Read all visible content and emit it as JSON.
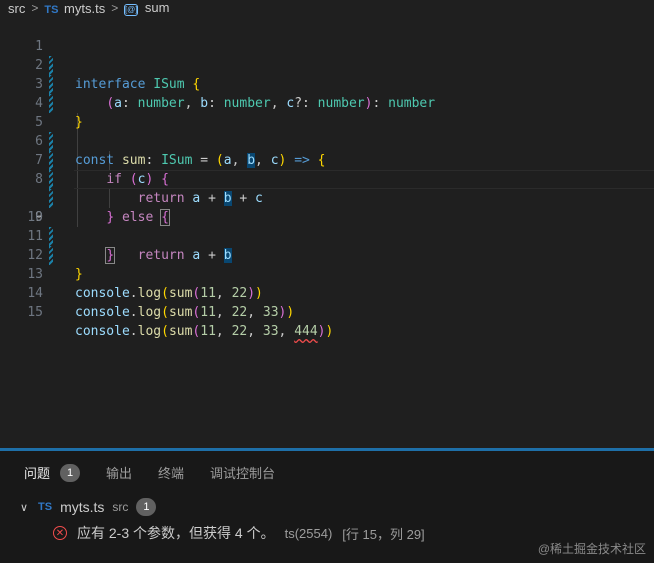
{
  "breadcrumb": {
    "folder": "src",
    "file_lang": "TS",
    "file": "myts.ts",
    "symbol_icon": "symbol-variable-icon",
    "symbol": "sum"
  },
  "editor": {
    "line_numbers": [
      "1",
      "2",
      "3",
      "4",
      "5",
      "6",
      "7",
      "8",
      "9",
      "10",
      "11",
      "12",
      "13",
      "14",
      "15"
    ],
    "active_line": "9"
  },
  "panel": {
    "tabs": [
      {
        "label": "问题",
        "badge": "1"
      },
      {
        "label": "输出"
      },
      {
        "label": "终端"
      },
      {
        "label": "调试控制台"
      }
    ],
    "file": {
      "lang": "TS",
      "name": "myts.ts",
      "dir": "src",
      "count": "1"
    },
    "error": {
      "message": "应有 2-3 个参数，但获得 4 个。",
      "code": "ts(2554)",
      "location": "[行 15，列 29]"
    }
  },
  "watermark": "@稀土掘金技术社区",
  "colors": {
    "accent": "#1e6fa8",
    "error": "#f14c4c",
    "ts_blue": "#3178c6"
  }
}
